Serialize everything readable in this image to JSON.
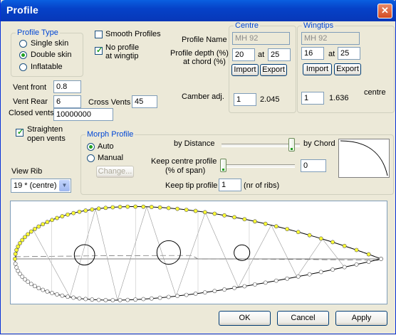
{
  "window": {
    "title": "Profile",
    "close_glyph": "✕"
  },
  "profile_type": {
    "title": "Profile Type",
    "options": [
      {
        "label": "Single skin",
        "selected": false
      },
      {
        "label": "Double skin",
        "selected": true
      },
      {
        "label": "Inflatable",
        "selected": false
      }
    ]
  },
  "smooth_profiles": {
    "label": "Smooth Profiles",
    "checked": false
  },
  "no_profile_wingtip": {
    "label_line1": "No profile",
    "label_line2": "at wingtip",
    "checked": true
  },
  "labels": {
    "profile_name": "Profile Name",
    "profile_depth_l1": "Profile depth (%)",
    "profile_depth_l2": "at chord (%)",
    "at": "at",
    "camber_adj": "Camber adj.",
    "centre_side": "centre"
  },
  "centre": {
    "title": "Centre",
    "profile_name": "MH 92",
    "depth": "20",
    "chord": "25",
    "import_label": "Import",
    "export_label": "Export",
    "camber": "1",
    "camber_value": "2.045"
  },
  "wingtips": {
    "title": "Wingtips",
    "profile_name": "MH 92",
    "depth": "16",
    "chord": "25",
    "import_label": "Import",
    "export_label": "Export",
    "camber": "1",
    "camber_value": "1.636"
  },
  "vents": {
    "front_label": "Vent front",
    "front": "0.8",
    "rear_label": "Vent Rear",
    "rear": "6",
    "closed_label": "Closed vents",
    "closed": "10000000",
    "cross_label": "Cross Vents",
    "cross": "45"
  },
  "straighten": {
    "label_line1": "Straighten",
    "label_line2": "open vents",
    "checked": true
  },
  "view_rib": {
    "label": "View Rib",
    "value": "19 * (centre)"
  },
  "morph": {
    "title": "Morph Profile",
    "auto_label": "Auto",
    "manual_label": "Manual",
    "mode": "Auto",
    "change_label": "Change...",
    "by_distance": "by Distance",
    "by_chord": "by Chord",
    "slider_level": 0.97,
    "keep_centre_l1": "Keep centre profile",
    "keep_centre_l2": "(% of span)",
    "keep_centre_slider": 0.0,
    "keep_centre": "0",
    "keep_tip_label": "Keep tip profile",
    "keep_tip": "1",
    "keep_tip_unit": "(nr of ribs)"
  },
  "buttons": {
    "ok": "OK",
    "cancel": "Cancel",
    "apply": "Apply"
  },
  "colors": {
    "title_bar": "#0a5fe0",
    "group_title": "#0046d5",
    "check_mark": "#21a121",
    "upper_points": "#ffff33"
  }
}
